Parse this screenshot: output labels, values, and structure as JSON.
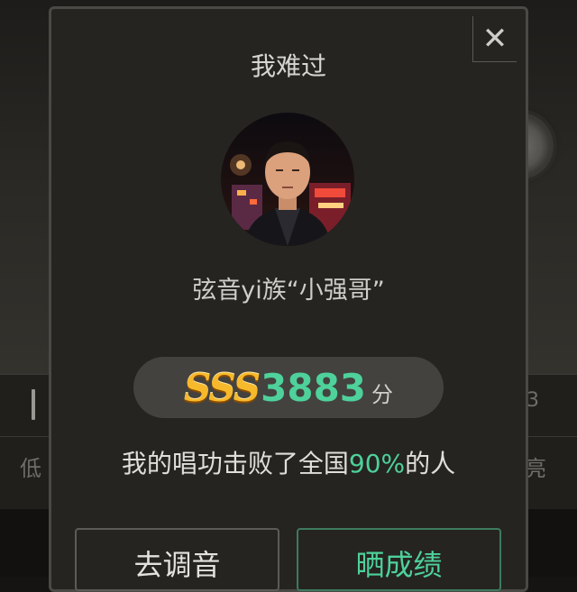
{
  "background": {
    "left_label": "低",
    "right_label": "亮",
    "right_number": "3"
  },
  "dialog": {
    "title": "我难过",
    "close_icon": "close-icon",
    "avatar_icon": "user-avatar",
    "user_name": "弦音yi族“小强哥”",
    "score": {
      "grade": "SSS",
      "value": "3883",
      "unit": "分"
    },
    "result": {
      "prefix": "我的唱功击败了全国",
      "percent": "90%",
      "suffix": "的人"
    },
    "buttons": {
      "tune": "去调音",
      "share": "晒成绩"
    }
  },
  "colors": {
    "accent": "#4ed19a",
    "grade": "#f6b92c"
  }
}
